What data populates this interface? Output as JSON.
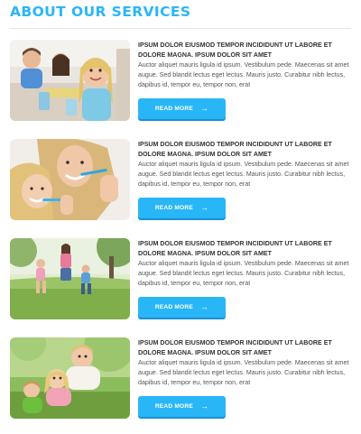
{
  "header": {
    "title": "ABOUT OUR SERVICES"
  },
  "colors": {
    "accent": "#29b6f6",
    "accent_dark": "#1a8fd6"
  },
  "services": [
    {
      "title": "IPSUM DOLOR EIUSMOD TEMPOR INCIDIDUNT UT LABORE ET DOLORE MAGNA. IPSUM DOLOR SIT AMET",
      "desc": "Auctor aliquet mauris ligula id ipsum. Vestibulum pede. Maecenas sit amet augue. Sed blandit lectus eget lectus. Mauris justo. Curabitur nibh lectus, dapibus id, tempor eu, tempor non, erat",
      "button": "READ MORE",
      "image": "children-eating-photo"
    },
    {
      "title": "IPSUM DOLOR EIUSMOD TEMPOR INCIDIDUNT UT LABORE ET DOLORE MAGNA. IPSUM DOLOR SIT AMET",
      "desc": "Auctor aliquet mauris ligula id ipsum. Vestibulum pede. Maecenas sit amet augue. Sed blandit lectus eget lectus. Mauris justo. Curabitur nibh lectus, dapibus id, tempor eu, tempor non, erat",
      "button": "READ MORE",
      "image": "mother-daughter-brushing-teeth-photo"
    },
    {
      "title": "IPSUM DOLOR EIUSMOD TEMPOR INCIDIDUNT UT LABORE ET DOLORE MAGNA. IPSUM DOLOR SIT AMET",
      "desc": "Auctor aliquet mauris ligula id ipsum. Vestibulum pede. Maecenas sit amet augue. Sed blandit lectus eget lectus. Mauris justo. Curabitur nibh lectus, dapibus id, tempor eu, tempor non, erat",
      "button": "READ MORE",
      "image": "family-running-park-photo"
    },
    {
      "title": "IPSUM DOLOR EIUSMOD TEMPOR INCIDIDUNT UT LABORE ET DOLORE MAGNA. IPSUM DOLOR SIT AMET",
      "desc": "Auctor aliquet mauris ligula id ipsum. Vestibulum pede. Maecenas sit amet augue. Sed blandit lectus eget lectus. Mauris justo. Curabitur nibh lectus, dapibus id, tempor eu, tempor non, erat",
      "button": "READ MORE",
      "image": "children-playing-grass-photo"
    }
  ]
}
